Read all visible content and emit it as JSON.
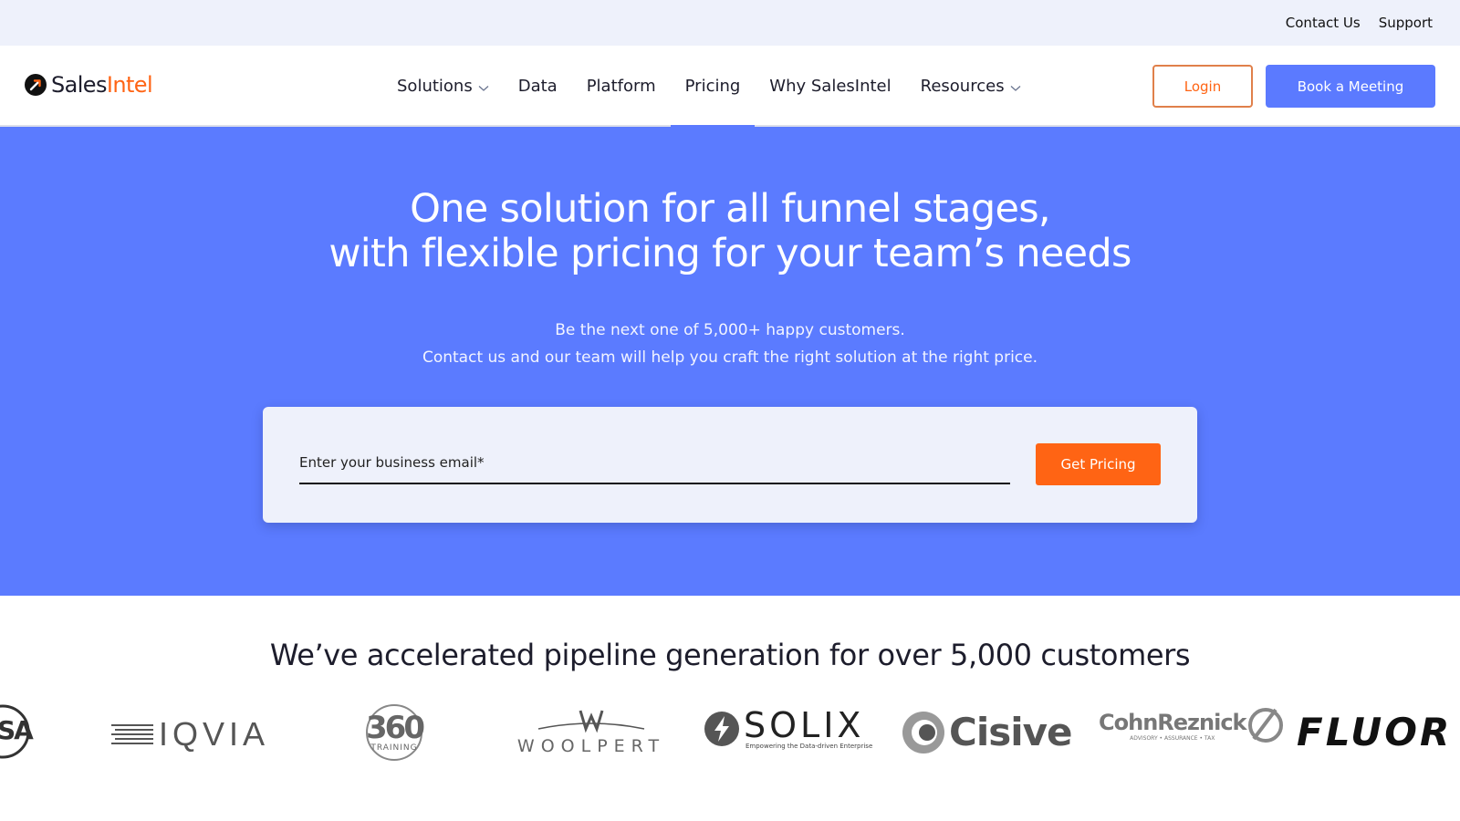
{
  "topbar": {
    "contact": "Contact Us",
    "support": "Support"
  },
  "brand": {
    "sales": "Sales",
    "intel": "Intel",
    "accent": "#ff6414",
    "primary": "#5b7aff"
  },
  "nav": {
    "items": [
      {
        "label": "Solutions",
        "dropdown": true
      },
      {
        "label": "Data",
        "dropdown": false
      },
      {
        "label": "Platform",
        "dropdown": false
      },
      {
        "label": "Pricing",
        "dropdown": false,
        "active": true
      },
      {
        "label": "Why SalesIntel",
        "dropdown": false
      },
      {
        "label": "Resources",
        "dropdown": true
      }
    ],
    "login": "Login",
    "book": "Book a Meeting"
  },
  "hero": {
    "title_line1": "One solution for all funnel stages,",
    "title_line2": "with flexible pricing for your team’s needs",
    "sub_line1": "Be the next one of 5,000+ happy customers.",
    "sub_line2": "Contact us and our team will help you craft the right solution at the right price.",
    "background": "#5b7bff"
  },
  "form": {
    "email_label": "Enter your business email*",
    "button": "Get Pricing"
  },
  "customers": {
    "title": "We’ve accelerated pipeline generation for over 5,000 customers",
    "logos": {
      "first": "SA",
      "iqvia": "IQVIA",
      "t360": "360",
      "t360_sub": "TRAINING",
      "woolpert": "WOOLPERT",
      "solix": "SOLIX",
      "solix_sub": "Empowering the Data-driven Enterprise",
      "cisive": "Cisive",
      "cohn": "CohnReznick",
      "cohn_sub": "ADVISORY • ASSURANCE • TAX",
      "fluor": "FLUOR"
    }
  }
}
